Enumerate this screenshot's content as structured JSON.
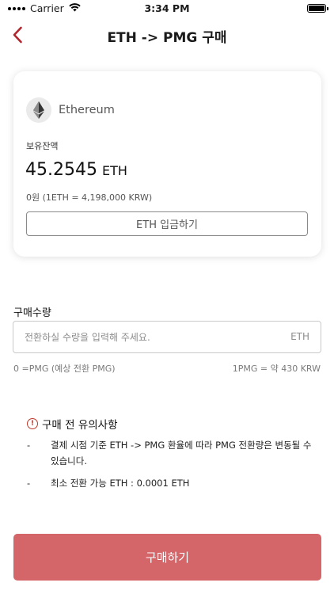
{
  "status_bar": {
    "carrier": "Carrier",
    "time": "3:34 PM"
  },
  "nav": {
    "title": "ETH -> PMG 구매"
  },
  "wallet_card": {
    "coin_name": "Ethereum",
    "balance_label": "보유잔액",
    "balance_value": "45.2545",
    "balance_unit": "ETH",
    "krw_value": "0원 (1ETH = 4,198,000 KRW)",
    "deposit_button": "ETH 입금하기"
  },
  "purchase": {
    "quantity_label": "구매수량",
    "quantity_placeholder": "전환하실 수량을 입력해 주세요.",
    "quantity_unit": "ETH",
    "estimate_text": "0 =PMG (예상 전환 PMG)",
    "rate_text": "1PMG = 약 430 KRW"
  },
  "notice": {
    "title": "구매 전 유의사항",
    "items": [
      {
        "dash": "-",
        "text": "결제 시점 기준 ETH -> PMG 환율에 따라 PMG 전환량은 변동될 수 있습니다."
      },
      {
        "dash": "-",
        "text": "최소 전환 가능 ETH : 0.0001 ETH"
      }
    ]
  },
  "buy_button": "구매하기",
  "colors": {
    "accent": "#d46569",
    "back_arrow": "#b3262e",
    "warning": "#c0392b"
  }
}
